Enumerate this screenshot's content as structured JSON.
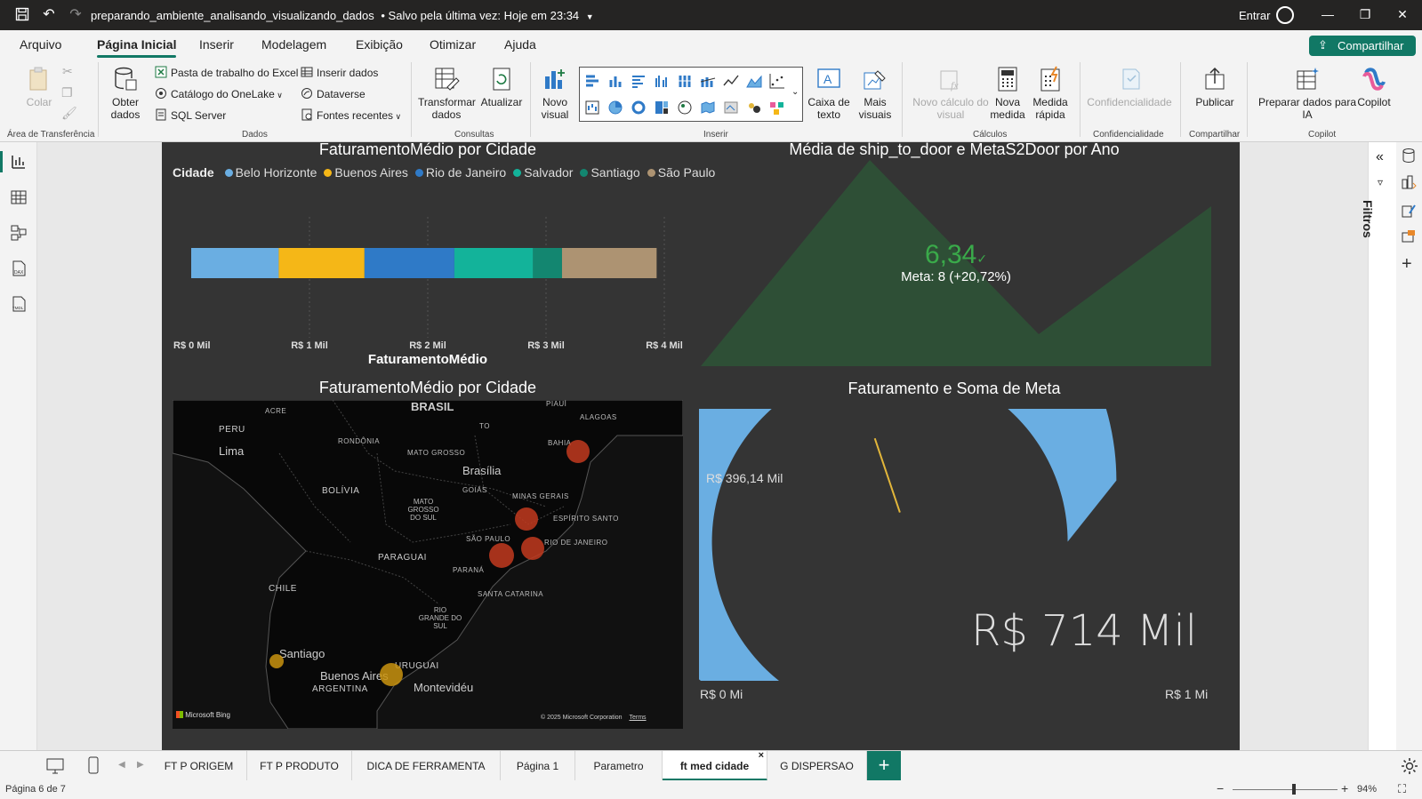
{
  "titlebar": {
    "file_name": "preparando_ambiente_analisando_visualizando_dados",
    "saved_status": "• Salvo pela última vez: Hoje em 23:34",
    "signin": "Entrar"
  },
  "menu": [
    "Arquivo",
    "Página Inicial",
    "Inserir",
    "Modelagem",
    "Exibição",
    "Otimizar",
    "Ajuda"
  ],
  "share_button": "Compartilhar",
  "ribbon": {
    "clipboard": {
      "paste": "Colar",
      "group": "Área de Transferência"
    },
    "data": {
      "get_data": "Obter dados",
      "excel": "Pasta de trabalho do Excel",
      "onelake": "Catálogo do OneLake",
      "sql": "SQL Server",
      "insert_data": "Inserir dados",
      "dataverse": "Dataverse",
      "recent": "Fontes recentes",
      "group": "Dados"
    },
    "queries": {
      "transform": "Transformar dados",
      "refresh": "Atualizar",
      "group": "Consultas"
    },
    "insert": {
      "new_visual": "Novo visual",
      "text_box": "Caixa de texto",
      "more_visuals": "Mais visuais",
      "group": "Inserir"
    },
    "calc": {
      "new_calc": "Novo cálculo do visual",
      "new_measure": "Nova medida",
      "quick_measure": "Medida rápida",
      "group": "Cálculos"
    },
    "sensitivity": {
      "label": "Confidencialidade",
      "group": "Confidencialidade"
    },
    "share": {
      "publish": "Publicar",
      "group": "Compartilhar"
    },
    "copilot": {
      "prepare": "Preparar dados para IA",
      "copilot": "Copilot",
      "group": "Copilot"
    }
  },
  "filters_label": "Filtros",
  "visuals": {
    "bar": {
      "title": "FaturamentoMédio por Cidade",
      "legend_title": "Cidade",
      "xlabel": "FaturamentoMédio",
      "ticks": [
        "R$ 0 Mil",
        "R$ 1 Mil",
        "R$ 2 Mil",
        "R$ 3 Mil",
        "R$ 4 Mil"
      ]
    },
    "kpi": {
      "title": "Média de ship_to_door e MetaS2Door por Ano",
      "value": "6,34",
      "goal": "Meta: 8 (+20,72%)"
    },
    "map": {
      "title": "FaturamentoMédio por Cidade",
      "labels": {
        "brasil": "BRASIL",
        "peru": "PERU",
        "lima": "Lima",
        "acre": "ACRE",
        "rondonia": "RONDÔNIA",
        "mato_grosso": "MATO GROSSO",
        "bolivia": "BOLÍVIA",
        "brasilia": "Brasília",
        "goias": "GOIÁS",
        "minas": "MINAS GERAIS",
        "ms": "MATO GROSSO DO SUL",
        "sp": "SÃO PAULO",
        "paraguai": "PARAGUAI",
        "parana": "PARANÁ",
        "sc": "SANTA CATARINA",
        "rs": "RIO GRANDE DO SUL",
        "chile": "CHILE",
        "santiago": "Santiago",
        "buenos_aires": "Buenos Aires",
        "argentina": "ARGENTINA",
        "uruguai": "URUGUAI",
        "montevideu": "Montevidéu",
        "bahia": "BAHIA",
        "alagoas": "ALAGOAS",
        "piaui": "PIAUÍ",
        "es": "ESPÍRITO SANTO",
        "rj": "RIO DE JANEIRO",
        "to": "TO"
      },
      "bing": "Microsoft Bing",
      "copyright": "© 2025 Microsoft Corporation",
      "terms": "Terms"
    },
    "gauge": {
      "title": "Faturamento e Soma de Meta",
      "target_label": "R$ 396,14 Mil",
      "value_label": "R$ 714 Mil",
      "min_label": "R$ 0 Mi",
      "max_label": "R$ 1 Mi"
    }
  },
  "chart_data": [
    {
      "type": "bar",
      "title": "FaturamentoMédio por Cidade",
      "xlabel": "FaturamentoMédio",
      "xlim": [
        0,
        4000
      ],
      "orientation": "horizontal-stacked",
      "series": [
        {
          "name": "Belo Horizonte",
          "value": 740,
          "color": "#6aaee2"
        },
        {
          "name": "Buenos Aires",
          "value": 725,
          "color": "#f5b717"
        },
        {
          "name": "Rio de Janeiro",
          "value": 760,
          "color": "#2f7ac7"
        },
        {
          "name": "Salvador",
          "value": 665,
          "color": "#13b39a"
        },
        {
          "name": "Santiago",
          "value": 245,
          "color": "#138670"
        },
        {
          "name": "São Paulo",
          "value": 800,
          "color": "#ad9372"
        }
      ],
      "legend": "top-left"
    },
    {
      "type": "area",
      "title": "Média de ship_to_door e MetaS2Door por Ano",
      "kpi_value": 6.34,
      "goal": 8,
      "goal_delta_pct": 20.72,
      "color": "#2e4f36"
    },
    {
      "type": "gauge",
      "title": "Faturamento e Soma de Meta",
      "value": 714,
      "target": 396.14,
      "min": 0,
      "max": 1000,
      "unit": "R$ Mil",
      "fill_color": "#6aaee2",
      "target_color": "#e2b63a"
    }
  ],
  "map_points": [
    {
      "city": "Salvador",
      "color": "#c2391e"
    },
    {
      "city": "Belo Horizonte",
      "color": "#c2391e"
    },
    {
      "city": "Rio de Janeiro",
      "color": "#c2391e"
    },
    {
      "city": "São Paulo",
      "color": "#c2391e"
    },
    {
      "city": "Santiago",
      "color": "#c9930f"
    },
    {
      "city": "Buenos Aires",
      "color": "#c9930f"
    }
  ],
  "pages": [
    "FT P ORIGEM",
    "FT P PRODUTO",
    "DICA DE FERRAMENTA",
    "Página 1",
    "Parametro",
    "ft med cidade",
    "G DISPERSAO"
  ],
  "active_page": "ft med cidade",
  "status": {
    "page": "Página 6 de 7",
    "zoom": "94%"
  }
}
